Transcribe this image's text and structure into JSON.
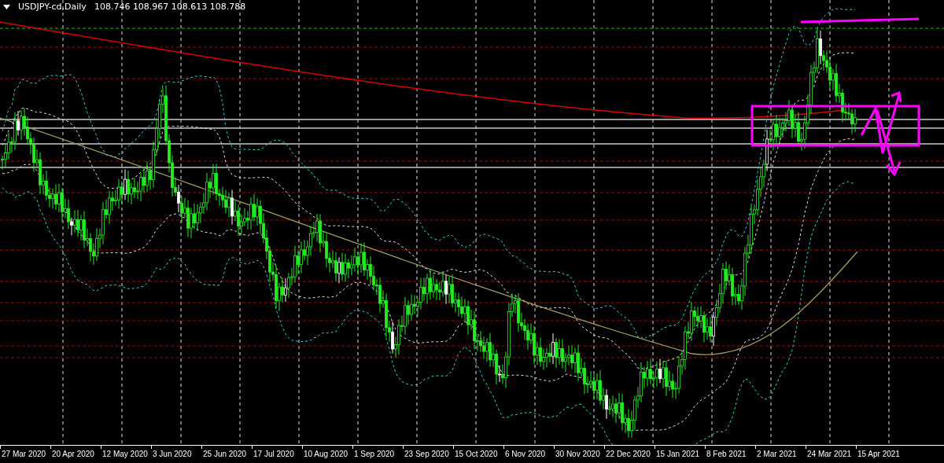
{
  "chart": {
    "symbol": "USDJPY-cd,Daily",
    "ohlc": "108.746 108.967 108.613 108.788"
  },
  "time_axis": {
    "labels": [
      "27 Mar 2020",
      "20 Apr 2020",
      "12 May 2020",
      "3 Jun 2020",
      "25 Jun 2020",
      "17 Jul 2020",
      "10 Aug 2020",
      "1 Sep 2020",
      "23 Sep 2020",
      "15 Oct 2020",
      "6 Nov 2020",
      "30 Nov 2020",
      "22 Dec 2020",
      "15 Jan 2021",
      "8 Feb 2021",
      "2 Mar 2021",
      "24 Mar 2021",
      "15 Apr 2021"
    ]
  }
}
